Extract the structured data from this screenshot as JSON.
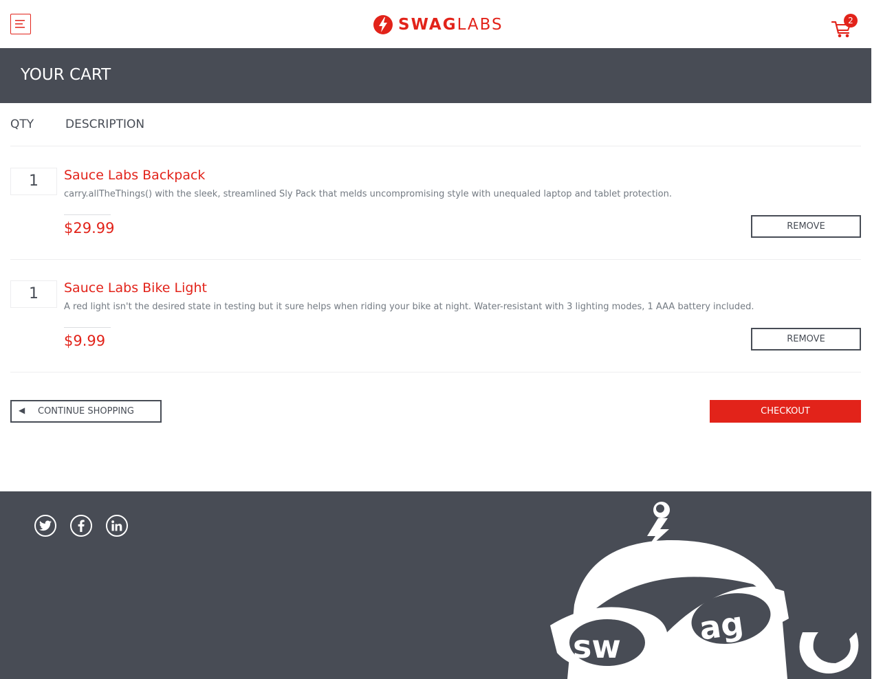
{
  "header": {
    "logo_swag": "SWAG",
    "logo_labs": "LABS",
    "cart_count": "2"
  },
  "subheader": {
    "title": "YOUR CART"
  },
  "cart": {
    "qty_label": "QTY",
    "desc_label": "DESCRIPTION",
    "items": [
      {
        "qty": "1",
        "name": "Sauce Labs Backpack",
        "description": "carry.allTheThings() with the sleek, streamlined Sly Pack that melds uncompromising style with unequaled laptop and tablet protection.",
        "price": "$29.99",
        "remove_label": "REMOVE"
      },
      {
        "qty": "1",
        "name": "Sauce Labs Bike Light",
        "description": "A red light isn't the desired state in testing but it sure helps when riding your bike at night. Water-resistant with 3 lighting modes, 1 AAA battery included.",
        "price": "$9.99",
        "remove_label": "REMOVE"
      }
    ],
    "continue_arrow": "◀",
    "continue_label": "CONTINUE SHOPPING",
    "checkout_label": "CHECKOUT"
  },
  "footer": {
    "social": [
      "twitter-icon",
      "facebook-icon",
      "linkedin-icon"
    ],
    "robot_text": "swag"
  },
  "colors": {
    "accent": "#e2231a",
    "dark": "#484c55"
  }
}
